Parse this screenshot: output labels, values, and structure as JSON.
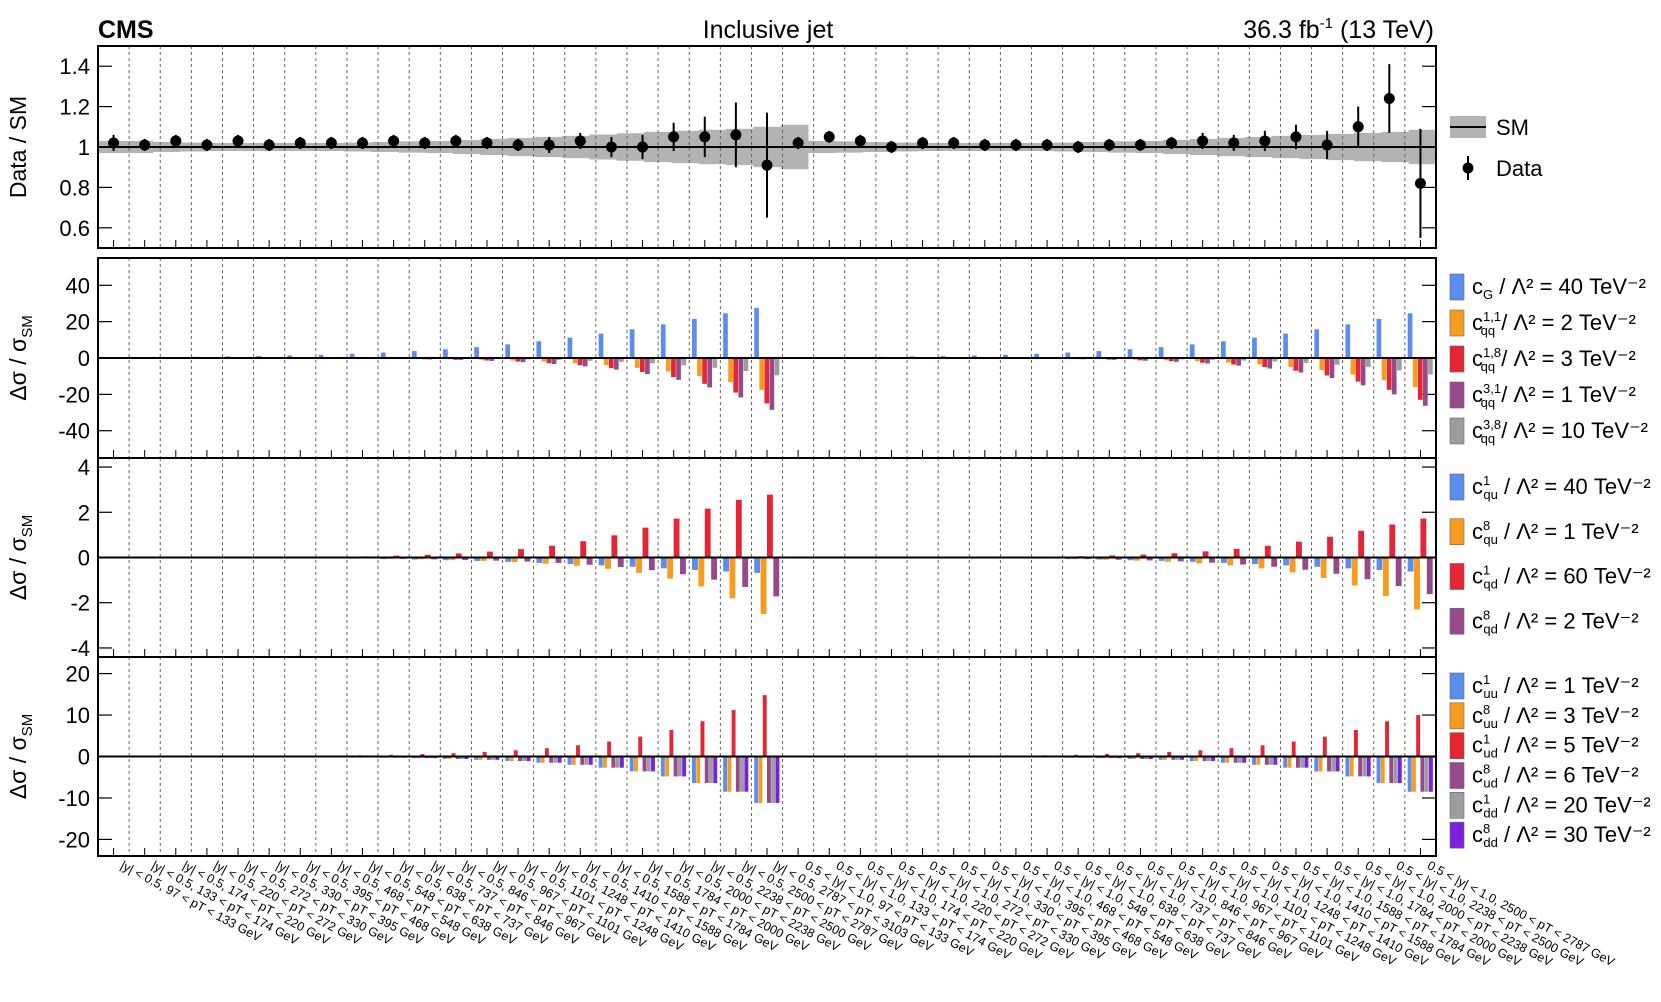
{
  "header": {
    "experiment": "CMS",
    "title": "Inclusive jet",
    "lumi": "36.3 fb",
    "lumi_sup": "-1",
    "energy": " (13 TeV)"
  },
  "chart_data": [
    {
      "type": "scatter",
      "panel": "ratio",
      "ylabel": "Data / SM",
      "ylim": [
        0.5,
        1.5
      ],
      "yticks": [
        0.6,
        0.8,
        1,
        1.2,
        1.4
      ],
      "legend": [
        {
          "label": "SM",
          "marker": "line",
          "color": "#000000",
          "band": "#b3b3b3"
        },
        {
          "label": "Data",
          "marker": "point",
          "color": "#000000"
        }
      ],
      "band_halfwidth": [
        0.03,
        0.03,
        0.025,
        0.022,
        0.02,
        0.02,
        0.02,
        0.02,
        0.02,
        0.022,
        0.025,
        0.028,
        0.03,
        0.035,
        0.04,
        0.045,
        0.05,
        0.055,
        0.062,
        0.068,
        0.075,
        0.08,
        0.085,
        0.09,
        0.1,
        0.11,
        0.03,
        0.028,
        0.025,
        0.022,
        0.02,
        0.02,
        0.02,
        0.02,
        0.02,
        0.022,
        0.025,
        0.028,
        0.03,
        0.035,
        0.04,
        0.045,
        0.05,
        0.055,
        0.06,
        0.065,
        0.07,
        0.075,
        0.085
      ],
      "data": [
        1.02,
        1.01,
        1.03,
        1.01,
        1.03,
        1.01,
        1.02,
        1.02,
        1.02,
        1.03,
        1.02,
        1.03,
        1.02,
        1.01,
        1.01,
        1.03,
        1.0,
        1.0,
        1.05,
        1.05,
        1.06,
        0.91,
        1.02,
        1.05,
        1.03,
        1.0,
        1.02,
        1.02,
        1.01,
        1.01,
        1.01,
        1.0,
        1.01,
        1.01,
        1.02,
        1.03,
        1.02,
        1.03,
        1.05,
        1.01,
        1.1,
        1.24,
        0.82
      ],
      "errors": [
        0.04,
        0.03,
        0.03,
        0.03,
        0.03,
        0.03,
        0.03,
        0.03,
        0.03,
        0.03,
        0.03,
        0.03,
        0.03,
        0.03,
        0.04,
        0.04,
        0.05,
        0.06,
        0.07,
        0.1,
        0.16,
        0.26,
        0.03,
        0.03,
        0.03,
        0.03,
        0.03,
        0.03,
        0.03,
        0.03,
        0.03,
        0.03,
        0.03,
        0.03,
        0.03,
        0.04,
        0.04,
        0.05,
        0.06,
        0.07,
        0.1,
        0.17,
        0.27
      ]
    },
    {
      "type": "bar",
      "panel": "group1",
      "ylabel": "Δσ / σ",
      "ylabel_sub": "SM",
      "ylim": [
        -55,
        55
      ],
      "yticks": [
        -40,
        -20,
        0,
        20,
        40
      ],
      "series": [
        {
          "base": "c",
          "sub": "G",
          "sup": "",
          "rest": " / Λ² = 40 TeV⁻²",
          "color": "#5b8def",
          "values": [
            0.3,
            0.4,
            0.5,
            0.7,
            0.9,
            1.1,
            1.4,
            1.8,
            2.3,
            3.0,
            3.8,
            4.8,
            6.0,
            7.5,
            9.2,
            11.2,
            13.4,
            15.8,
            18.5,
            21.5,
            24.6,
            27.6,
            0.3,
            0.4,
            0.5,
            0.7,
            0.9,
            1.1,
            1.4,
            1.8,
            2.3,
            3.0,
            3.8,
            4.8,
            6.0,
            7.5,
            9.2,
            11.2,
            13.4,
            15.8,
            18.5,
            21.5,
            24.6
          ]
        },
        {
          "base": "c",
          "sub": "qq",
          "sup": "1,1",
          "rest": " / Λ² = 2 TeV⁻²",
          "color": "#f89c20",
          "values": [
            0,
            0,
            0,
            0,
            0,
            0,
            -0.1,
            -0.1,
            -0.2,
            -0.3,
            -0.5,
            -0.7,
            -1.0,
            -1.4,
            -2.0,
            -2.8,
            -3.9,
            -5.4,
            -7.4,
            -10.0,
            -13.3,
            -17.5,
            0,
            0,
            0,
            0,
            0,
            0,
            -0.1,
            -0.2,
            -0.3,
            -0.4,
            -0.6,
            -0.9,
            -1.3,
            -1.8,
            -2.5,
            -3.5,
            -4.9,
            -6.7,
            -9.1,
            -12.2,
            -16.0
          ]
        },
        {
          "base": "c",
          "sub": "qq",
          "sup": "1,8",
          "rest": " / Λ² = 3 TeV⁻²",
          "color": "#e42536",
          "values": [
            0,
            0,
            0,
            0,
            0,
            0,
            -0.1,
            -0.1,
            -0.3,
            -0.4,
            -0.7,
            -1.0,
            -1.4,
            -2.0,
            -2.9,
            -4.0,
            -5.6,
            -7.7,
            -10.5,
            -14.2,
            -19.0,
            -25.0,
            0,
            0,
            0,
            0,
            0,
            0,
            -0.1,
            -0.2,
            -0.4,
            -0.6,
            -0.9,
            -1.3,
            -1.8,
            -2.6,
            -3.6,
            -5.0,
            -7.0,
            -9.6,
            -13.0,
            -17.5,
            -23.0
          ]
        },
        {
          "base": "c",
          "sub": "qq",
          "sup": "3,1",
          "rest": " / Λ² = 1 TeV⁻²",
          "color": "#964a8b",
          "values": [
            0,
            0,
            0,
            0,
            0,
            0,
            -0.1,
            -0.2,
            -0.3,
            -0.5,
            -0.8,
            -1.1,
            -1.6,
            -2.3,
            -3.3,
            -4.6,
            -6.4,
            -8.8,
            -12.0,
            -16.2,
            -21.7,
            -28.5,
            0,
            0,
            0,
            0,
            0,
            0,
            -0.1,
            -0.2,
            -0.4,
            -0.7,
            -1.0,
            -1.5,
            -2.1,
            -3.0,
            -4.2,
            -5.8,
            -8.0,
            -11.0,
            -15.0,
            -20.0,
            -26.3
          ]
        },
        {
          "base": "c",
          "sub": "qq",
          "sup": "3,8",
          "rest": " / Λ² = 10 TeV⁻²",
          "color": "#9c9ca1",
          "values": [
            0,
            0,
            0,
            0,
            0,
            0,
            0,
            -0.1,
            -0.1,
            -0.2,
            -0.3,
            -0.4,
            -0.6,
            -0.8,
            -1.1,
            -1.5,
            -2.1,
            -2.9,
            -4.0,
            -5.4,
            -7.2,
            -9.5,
            0,
            0,
            0,
            0,
            0,
            0,
            0,
            -0.1,
            -0.1,
            -0.2,
            -0.3,
            -0.5,
            -0.7,
            -1.0,
            -1.4,
            -1.9,
            -2.7,
            -3.7,
            -5.0,
            -6.8,
            -9.0
          ]
        }
      ]
    },
    {
      "type": "bar",
      "panel": "group2",
      "ylabel": "Δσ / σ",
      "ylabel_sub": "SM",
      "ylim": [
        -4.4,
        4.4
      ],
      "yticks": [
        -4,
        -2,
        0,
        2,
        4
      ],
      "series": [
        {
          "base": "c",
          "sub": "qu",
          "sup": "1",
          "rest": " / Λ² = 40 TeV⁻²",
          "color": "#5b8def",
          "values": [
            0,
            0,
            0,
            0,
            0,
            -0.02,
            -0.03,
            -0.04,
            -0.05,
            -0.07,
            -0.09,
            -0.12,
            -0.15,
            -0.19,
            -0.24,
            -0.29,
            -0.35,
            -0.41,
            -0.48,
            -0.55,
            -0.62,
            -0.68,
            0,
            0,
            0,
            0,
            0,
            -0.02,
            -0.03,
            -0.04,
            -0.05,
            -0.07,
            -0.09,
            -0.12,
            -0.15,
            -0.19,
            -0.24,
            -0.29,
            -0.35,
            -0.41,
            -0.48,
            -0.55,
            -0.62
          ]
        },
        {
          "base": "c",
          "sub": "qu",
          "sup": "8",
          "rest": " / Λ² = 1 TeV⁻²",
          "color": "#f89c20",
          "values": [
            0,
            0,
            0,
            0,
            0,
            -0.01,
            -0.02,
            -0.03,
            -0.04,
            -0.06,
            -0.08,
            -0.11,
            -0.15,
            -0.2,
            -0.27,
            -0.37,
            -0.5,
            -0.68,
            -0.93,
            -1.28,
            -1.8,
            -2.5,
            0,
            0,
            0,
            0,
            0,
            -0.01,
            -0.02,
            -0.03,
            -0.05,
            -0.07,
            -0.1,
            -0.14,
            -0.19,
            -0.26,
            -0.35,
            -0.48,
            -0.66,
            -0.9,
            -1.24,
            -1.7,
            -2.3
          ]
        },
        {
          "base": "c",
          "sub": "qd",
          "sup": "1",
          "rest": " / Λ² = 60 TeV⁻²",
          "color": "#e42536",
          "values": [
            0,
            0,
            0,
            0,
            0,
            0.01,
            0.02,
            0.03,
            0.05,
            0.08,
            0.12,
            0.18,
            0.26,
            0.37,
            0.52,
            0.72,
            0.98,
            1.32,
            1.72,
            2.16,
            2.55,
            2.78,
            0,
            0,
            0,
            0,
            0,
            0.01,
            0.02,
            0.03,
            0.04,
            0.06,
            0.09,
            0.13,
            0.19,
            0.27,
            0.38,
            0.52,
            0.7,
            0.92,
            1.18,
            1.46,
            1.72
          ]
        },
        {
          "base": "c",
          "sub": "qd",
          "sup": "8",
          "rest": " / Λ² = 2 TeV⁻²",
          "color": "#964a8b",
          "values": [
            0,
            0,
            0,
            0,
            0,
            -0.01,
            -0.02,
            -0.03,
            -0.04,
            -0.06,
            -0.08,
            -0.11,
            -0.14,
            -0.18,
            -0.24,
            -0.32,
            -0.42,
            -0.56,
            -0.74,
            -0.98,
            -1.3,
            -1.72,
            0,
            0,
            0,
            0,
            0,
            -0.01,
            -0.02,
            -0.03,
            -0.05,
            -0.07,
            -0.1,
            -0.13,
            -0.17,
            -0.23,
            -0.31,
            -0.41,
            -0.54,
            -0.72,
            -0.96,
            -1.26,
            -1.62
          ]
        }
      ]
    },
    {
      "type": "bar",
      "panel": "group3",
      "ylabel": "Δσ / σ",
      "ylabel_sub": "SM",
      "ylim": [
        -24,
        24
      ],
      "yticks": [
        -20,
        -10,
        0,
        10,
        20
      ],
      "series": [
        {
          "base": "c",
          "sub": "uu",
          "sup": "1",
          "rest": " / Λ² = 1 TeV⁻²",
          "color": "#5b8def",
          "values": [
            0,
            0,
            0,
            0,
            0,
            0,
            0,
            -0.1,
            -0.2,
            -0.3,
            -0.4,
            -0.6,
            -0.8,
            -1.1,
            -1.5,
            -2.0,
            -2.7,
            -3.6,
            -4.8,
            -6.4,
            -8.5,
            -11.2,
            0,
            0,
            0,
            0,
            0,
            0,
            0,
            -0.1,
            -0.2,
            -0.3,
            -0.4,
            -0.6,
            -0.8,
            -1.1,
            -1.5,
            -2.0,
            -2.7,
            -3.6,
            -4.8,
            -6.4,
            -8.5
          ]
        },
        {
          "base": "c",
          "sub": "uu",
          "sup": "8",
          "rest": " / Λ² = 3 TeV⁻²",
          "color": "#f89c20",
          "values": [
            0,
            0,
            0,
            0,
            0,
            0,
            0,
            -0.1,
            -0.2,
            -0.3,
            -0.4,
            -0.6,
            -0.8,
            -1.1,
            -1.5,
            -2.0,
            -2.7,
            -3.6,
            -4.8,
            -6.4,
            -8.5,
            -11.2,
            0,
            0,
            0,
            0,
            0,
            0,
            0,
            -0.1,
            -0.2,
            -0.3,
            -0.4,
            -0.6,
            -0.8,
            -1.1,
            -1.5,
            -2.0,
            -2.7,
            -3.6,
            -4.8,
            -6.4,
            -8.5
          ]
        },
        {
          "base": "c",
          "sub": "ud",
          "sup": "1",
          "rest": " / Λ² = 5 TeV⁻²",
          "color": "#e42536",
          "values": [
            0,
            0,
            0,
            0,
            0,
            0,
            0.1,
            0.2,
            0.3,
            0.4,
            0.6,
            0.8,
            1.1,
            1.5,
            2.0,
            2.7,
            3.6,
            4.8,
            6.4,
            8.5,
            11.2,
            14.8,
            0,
            0,
            0,
            0,
            0,
            0,
            0.1,
            0.2,
            0.3,
            0.4,
            0.6,
            0.8,
            1.1,
            1.5,
            2.0,
            2.7,
            3.6,
            4.8,
            6.4,
            8.5,
            10.0
          ]
        },
        {
          "base": "c",
          "sub": "ud",
          "sup": "8",
          "rest": " / Λ² = 6 TeV⁻²",
          "color": "#964a8b",
          "values": [
            0,
            0,
            0,
            0,
            0,
            0,
            0,
            -0.1,
            -0.2,
            -0.3,
            -0.4,
            -0.6,
            -0.8,
            -1.1,
            -1.5,
            -2.0,
            -2.7,
            -3.6,
            -4.8,
            -6.4,
            -8.5,
            -11.2,
            0,
            0,
            0,
            0,
            0,
            0,
            0,
            -0.1,
            -0.2,
            -0.3,
            -0.4,
            -0.6,
            -0.8,
            -1.1,
            -1.5,
            -2.0,
            -2.7,
            -3.6,
            -4.8,
            -6.4,
            -8.5
          ]
        },
        {
          "base": "c",
          "sub": "dd",
          "sup": "1",
          "rest": " / Λ² = 20 TeV⁻²",
          "color": "#9c9ca1",
          "values": [
            0,
            0,
            0,
            0,
            0,
            0,
            0,
            -0.1,
            -0.2,
            -0.3,
            -0.4,
            -0.6,
            -0.8,
            -1.1,
            -1.5,
            -2.0,
            -2.7,
            -3.6,
            -4.8,
            -6.4,
            -8.5,
            -11.2,
            0,
            0,
            0,
            0,
            0,
            0,
            0,
            -0.1,
            -0.2,
            -0.3,
            -0.4,
            -0.6,
            -0.8,
            -1.1,
            -1.5,
            -2.0,
            -2.7,
            -3.6,
            -4.8,
            -6.4,
            -8.5
          ]
        },
        {
          "base": "c",
          "sub": "dd",
          "sup": "8",
          "rest": " / Λ² = 30 TeV⁻²",
          "color": "#7a21dd",
          "values": [
            0,
            0,
            0,
            0,
            0,
            0,
            0,
            -0.1,
            -0.2,
            -0.3,
            -0.4,
            -0.6,
            -0.8,
            -1.1,
            -1.5,
            -2.0,
            -2.7,
            -3.6,
            -4.8,
            -6.4,
            -8.5,
            -11.2,
            0,
            0,
            0,
            0,
            0,
            0,
            0,
            -0.1,
            -0.2,
            -0.3,
            -0.4,
            -0.6,
            -0.8,
            -1.1,
            -1.5,
            -2.0,
            -2.7,
            -3.6,
            -4.8,
            -6.4,
            -8.5
          ]
        }
      ]
    }
  ],
  "bin_labels": [
    "|y| < 0.5, 97 < pT < 133 GeV",
    "|y| < 0.5, 133 < pT < 174 GeV",
    "|y| < 0.5, 174 < pT < 220 GeV",
    "|y| < 0.5, 220 < pT < 272 GeV",
    "|y| < 0.5, 272 < pT < 330 GeV",
    "|y| < 0.5, 330 < pT < 395 GeV",
    "|y| < 0.5, 395 < pT < 468 GeV",
    "|y| < 0.5, 468 < pT < 548 GeV",
    "|y| < 0.5, 548 < pT < 638 GeV",
    "|y| < 0.5, 638 < pT < 737 GeV",
    "|y| < 0.5, 737 < pT < 846 GeV",
    "|y| < 0.5, 846 < pT < 967 GeV",
    "|y| < 0.5, 967 < pT < 1101 GeV",
    "|y| < 0.5, 1101 < pT < 1248 GeV",
    "|y| < 0.5, 1248 < pT < 1410 GeV",
    "|y| < 0.5, 1410 < pT < 1588 GeV",
    "|y| < 0.5, 1588 < pT < 1784 GeV",
    "|y| < 0.5, 1784 < pT < 2000 GeV",
    "|y| < 0.5, 2000 < pT < 2238 GeV",
    "|y| < 0.5, 2238 < pT < 2500 GeV",
    "|y| < 0.5, 2500 < pT < 2787 GeV",
    "|y| < 0.5, 2787 < pT < 3103 GeV",
    "0.5 < |y| < 1.0, 97 < pT < 133 GeV",
    "0.5 < |y| < 1.0, 133 < pT < 174 GeV",
    "0.5 < |y| < 1.0, 174 < pT < 220 GeV",
    "0.5 < |y| < 1.0, 220 < pT < 272 GeV",
    "0.5 < |y| < 1.0, 272 < pT < 330 GeV",
    "0.5 < |y| < 1.0, 330 < pT < 395 GeV",
    "0.5 < |y| < 1.0, 395 < pT < 468 GeV",
    "0.5 < |y| < 1.0, 468 < pT < 548 GeV",
    "0.5 < |y| < 1.0, 548 < pT < 638 GeV",
    "0.5 < |y| < 1.0, 638 < pT < 737 GeV",
    "0.5 < |y| < 1.0, 737 < pT < 846 GeV",
    "0.5 < |y| < 1.0, 846 < pT < 967 GeV",
    "0.5 < |y| < 1.0, 967 < pT < 1101 GeV",
    "0.5 < |y| < 1.0, 1101 < pT < 1248 GeV",
    "0.5 < |y| < 1.0, 1248 < pT < 1410 GeV",
    "0.5 < |y| < 1.0, 1410 < pT < 1588 GeV",
    "0.5 < |y| < 1.0, 1588 < pT < 1784 GeV",
    "0.5 < |y| < 1.0, 1784 < pT < 2000 GeV",
    "0.5 < |y| < 1.0, 2000 < pT < 2238 GeV",
    "0.5 < |y| < 1.0, 2238 < pT < 2500 GeV",
    "0.5 < |y| < 1.0, 2500 < pT < 2787 GeV"
  ]
}
